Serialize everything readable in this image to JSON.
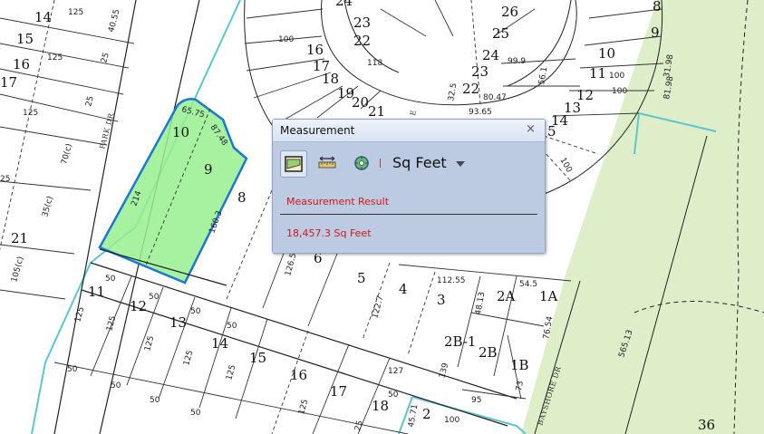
{
  "map": {
    "lots_top_left": [
      "14",
      "15",
      "16",
      "17",
      "125",
      "125",
      "125",
      "25",
      "25",
      "40.55"
    ],
    "lots_cul_de_sac": [
      "24",
      "23",
      "22",
      "16",
      "17",
      "18",
      "19",
      "20",
      "21",
      "26",
      "25",
      "24",
      "23",
      "22",
      "14",
      "13",
      "12",
      "11",
      "10",
      "9",
      "8",
      "5"
    ],
    "lots_main": [
      "10",
      "9",
      "8",
      "6",
      "5",
      "4",
      "3",
      "2A",
      "1A",
      "2B-1",
      "2B",
      "1B",
      "11",
      "12",
      "13",
      "14",
      "15",
      "16",
      "17",
      "18",
      "2",
      "21",
      "36"
    ],
    "dims": [
      "65.75",
      "87.48",
      "214",
      "160.3",
      "126.5",
      "122.7",
      "112.55",
      "54.5",
      "48.13",
      "76.54",
      "127",
      "73",
      "95",
      "100",
      "45.71",
      "50",
      "50",
      "50",
      "50",
      "125",
      "125",
      "125",
      "125",
      "125",
      "70(c)",
      "35(c)",
      "105(c)",
      "25",
      "100",
      "118",
      "99.9",
      "56.1",
      "80.47",
      "93.65",
      "32.5",
      "100",
      "100",
      "31.98",
      "81.98"
    ],
    "streets": [
      "PARK DR",
      "BAYSHORE DR"
    ],
    "highlight_color": "#97f08f",
    "highlight_stroke": "#1a78d4",
    "water_line_color": "#5bc6cf",
    "park_color": "#ddeec9"
  },
  "dialog": {
    "title": "Measurement",
    "close": "×",
    "tools": [
      "area-tool",
      "distance-tool",
      "location-tool"
    ],
    "unit": "Sq Feet",
    "result_label": "Measurement Result",
    "result_value": "18,457.3 Sq Feet"
  }
}
